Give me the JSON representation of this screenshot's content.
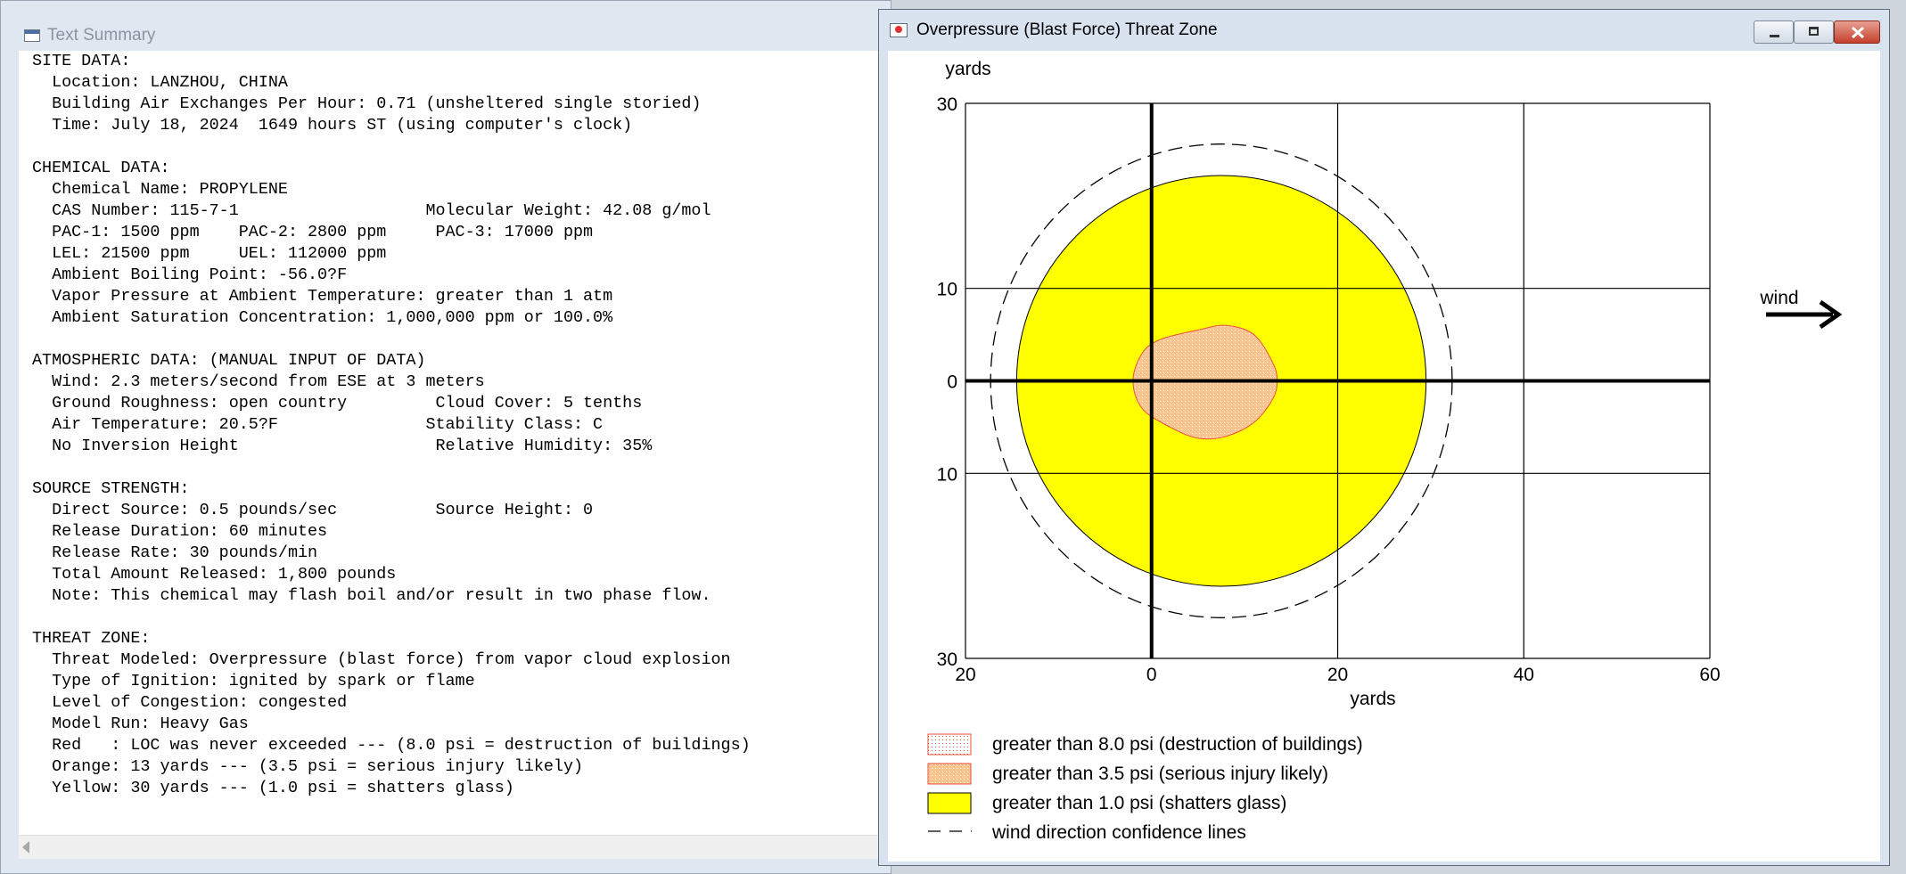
{
  "text_window": {
    "title": "Text Summary",
    "lines": [
      "SITE DATA:",
      "  Location: LANZHOU, CHINA",
      "  Building Air Exchanges Per Hour: 0.71 (unsheltered single storied)",
      "  Time: July 18, 2024  1649 hours ST (using computer's clock)",
      "",
      "CHEMICAL DATA:",
      "  Chemical Name: PROPYLENE",
      "  CAS Number: 115-7-1                   Molecular Weight: 42.08 g/mol",
      "  PAC-1: 1500 ppm    PAC-2: 2800 ppm     PAC-3: 17000 ppm",
      "  LEL: 21500 ppm     UEL: 112000 ppm",
      "  Ambient Boiling Point: -56.0?F",
      "  Vapor Pressure at Ambient Temperature: greater than 1 atm",
      "  Ambient Saturation Concentration: 1,000,000 ppm or 100.0%",
      "",
      "ATMOSPHERIC DATA: (MANUAL INPUT OF DATA)",
      "  Wind: 2.3 meters/second from ESE at 3 meters",
      "  Ground Roughness: open country         Cloud Cover: 5 tenths",
      "  Air Temperature: 20.5?F               Stability Class: C",
      "  No Inversion Height                    Relative Humidity: 35%",
      "",
      "SOURCE STRENGTH:",
      "  Direct Source: 0.5 pounds/sec          Source Height: 0",
      "  Release Duration: 60 minutes",
      "  Release Rate: 30 pounds/min",
      "  Total Amount Released: 1,800 pounds",
      "  Note: This chemical may flash boil and/or result in two phase flow.",
      "",
      "THREAT ZONE:",
      "  Threat Modeled: Overpressure (blast force) from vapor cloud explosion",
      "  Type of Ignition: ignited by spark or flame",
      "  Level of Congestion: congested",
      "  Model Run: Heavy Gas",
      "  Red   : LOC was never exceeded --- (8.0 psi = destruction of buildings)",
      "  Orange: 13 yards --- (3.5 psi = serious injury likely)",
      "  Yellow: 30 yards --- (1.0 psi = shatters glass)"
    ]
  },
  "zone_window": {
    "title": "Overpressure (Blast Force) Threat Zone",
    "controls": {
      "minimize_icon": "minimize-icon",
      "maximize_icon": "maximize-icon",
      "close_icon": "close-icon"
    }
  },
  "chart_data": {
    "type": "area",
    "ylabel": "yards",
    "xlabel": "yards",
    "xlim": [
      -20,
      60
    ],
    "ylim": [
      -30,
      30
    ],
    "x_ticks": [
      -20,
      0,
      20,
      40,
      60
    ],
    "x_tick_labels": [
      "20",
      "0",
      "20",
      "40",
      "60"
    ],
    "y_ticks": [
      30,
      10,
      0,
      -10,
      -30
    ],
    "y_tick_labels": [
      "30",
      "10",
      "0",
      "10",
      "30"
    ],
    "grid": true,
    "wind_label": "wind",
    "colors": {
      "orange": "#f9c48e",
      "orange_edge": "#e8503a",
      "yellow": "#ffff00",
      "axis": "#000000"
    },
    "zones": [
      {
        "name": "yellow",
        "psi": 1.0,
        "center": [
          7.5,
          0
        ],
        "rx": 22.0,
        "ry": 22.2
      },
      {
        "name": "orange",
        "psi": 3.5,
        "polygon": [
          [
            -2,
            0
          ],
          [
            -1,
            3
          ],
          [
            1,
            4.5
          ],
          [
            5,
            5.5
          ],
          [
            8,
            6
          ],
          [
            11,
            5
          ],
          [
            13,
            2
          ],
          [
            13.5,
            0
          ],
          [
            13,
            -2
          ],
          [
            11,
            -4.5
          ],
          [
            8,
            -6
          ],
          [
            5,
            -6.2
          ],
          [
            2,
            -5
          ],
          [
            -1,
            -3
          ]
        ]
      }
    ],
    "confidence_lines": {
      "center": [
        7.5,
        0
      ],
      "rx": 24.8,
      "ry": 25.6
    },
    "legend": [
      {
        "label": "greater than 8.0 psi (destruction of buildings)",
        "style": "red-dotted"
      },
      {
        "label": "greater than 3.5 psi (serious injury likely)",
        "style": "orange-dotted"
      },
      {
        "label": "greater than 1.0 psi (shatters glass)",
        "style": "yellow"
      },
      {
        "label": "wind direction confidence lines",
        "style": "dashed"
      }
    ]
  }
}
